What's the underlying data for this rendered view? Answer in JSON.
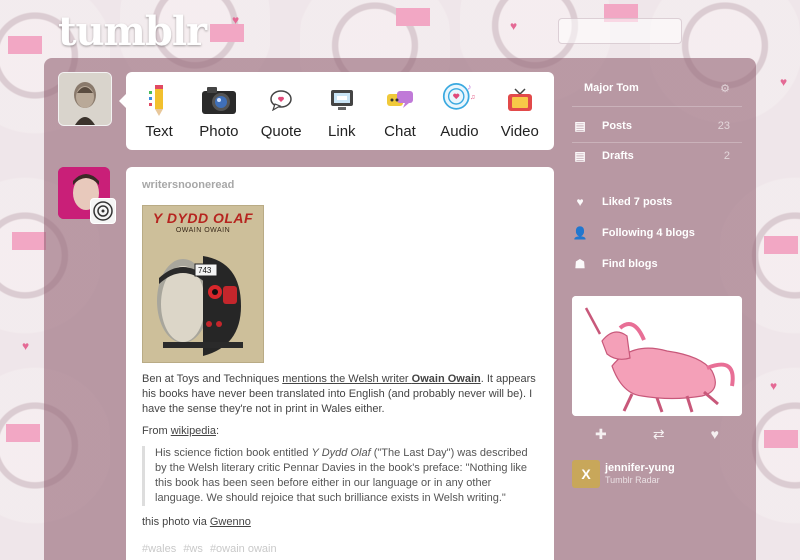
{
  "header": {
    "logo": "tumblr"
  },
  "post_types": [
    {
      "label": "Text",
      "icon": "text-pencil-icon"
    },
    {
      "label": "Photo",
      "icon": "camera-icon"
    },
    {
      "label": "Quote",
      "icon": "quote-bubble-icon"
    },
    {
      "label": "Link",
      "icon": "link-monitor-icon"
    },
    {
      "label": "Chat",
      "icon": "chat-icon"
    },
    {
      "label": "Audio",
      "icon": "headphones-icon"
    },
    {
      "label": "Video",
      "icon": "video-tv-icon"
    }
  ],
  "post": {
    "author": "writersnooneread",
    "book": {
      "title": "Y DYDD OLAF",
      "author": "OWAIN OWAIN",
      "badge": "743"
    },
    "p1_before": "Ben at Toys and Techniques ",
    "p1_link": "mentions the Welsh writer ",
    "p1_link_bold": "Owain Owain",
    "p1_after": ". It appears his books have never been translated into English (and probably never will be). I have the sense they're not in print in Wales either.",
    "from_label": "From ",
    "from_link": "wikipedia",
    "from_colon": ":",
    "quote_before": "His science fiction book entitled ",
    "quote_title": "Y Dydd Olaf",
    "quote_after": " (\"The Last Day\") was described by the Welsh literary critic Pennar Davies in the book's preface: \"Nothing like this book has been seen before either in our language or in any other language. We should rejoice that such brilliance exists in Welsh writing.\"",
    "via_label": "this photo via ",
    "via_link": "Gwenno",
    "tags": [
      "#wales",
      "#ws",
      "#owain owain"
    ]
  },
  "sidebar": {
    "user": "Major Tom",
    "posts_label": "Posts",
    "posts_count": "23",
    "drafts_label": "Drafts",
    "drafts_count": "2",
    "liked": "Liked 7 posts",
    "following": "Following 4 blogs",
    "find": "Find blogs",
    "spotlight_name": "jennifer-yung",
    "spotlight_sub": "Tumblr Radar",
    "spotlight_initial": "X"
  },
  "colors": {
    "overlay": "#96687f",
    "tag": "#c9c9c9",
    "book_title": "#b6241f"
  }
}
